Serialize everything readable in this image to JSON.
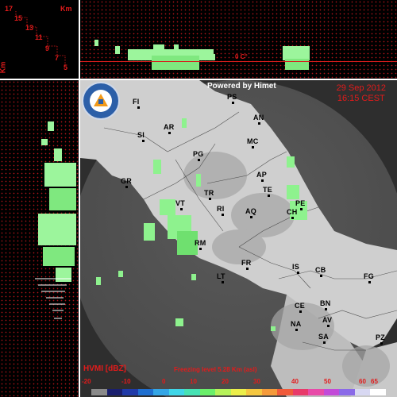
{
  "altitude_panel": {
    "unit": "Km",
    "unit_vertical": "Km",
    "levels": [
      "17",
      "15",
      "13",
      "11",
      "9",
      "7",
      "5"
    ]
  },
  "profile_top": {
    "freezing_marker": "0 C°"
  },
  "map": {
    "powered_by": "Powered by Himet",
    "date": "29 Sep 2012",
    "time": "16:15 CEST",
    "logo_text": "PROTEZIONE CIVILE · REGIONE ABRUZZO",
    "cities": [
      "FI",
      "PS",
      "AN",
      "AR",
      "SI",
      "MC",
      "PG",
      "GR",
      "AP",
      "TE",
      "TR",
      "VT",
      "RI",
      "AQ",
      "PE",
      "CH",
      "RM",
      "FR",
      "IS",
      "CB",
      "FG",
      "LT",
      "CE",
      "BN",
      "NA",
      "AV",
      "SA",
      "PZ"
    ]
  },
  "legend": {
    "title": "HVMI [dBZ]",
    "freezing_level": "Freezing level  5.28 Km (asl)",
    "ticks": [
      "-20",
      "-10",
      "0",
      "10",
      "20",
      "30",
      "40",
      "50",
      "60",
      "65"
    ],
    "colors": [
      "#8a8a8a",
      "#1a1f6e",
      "#203aa8",
      "#1f6fd0",
      "#34a6e6",
      "#3fd6e8",
      "#46e2b4",
      "#6aef6a",
      "#b6f25a",
      "#ecef4a",
      "#f5c740",
      "#f59a3a",
      "#f05a3a",
      "#e83a6a",
      "#e84aa8",
      "#c24ad8",
      "#8a6ae8",
      "#d8d8f2",
      "#ffffff"
    ]
  },
  "accent_color": "#e21b1b"
}
